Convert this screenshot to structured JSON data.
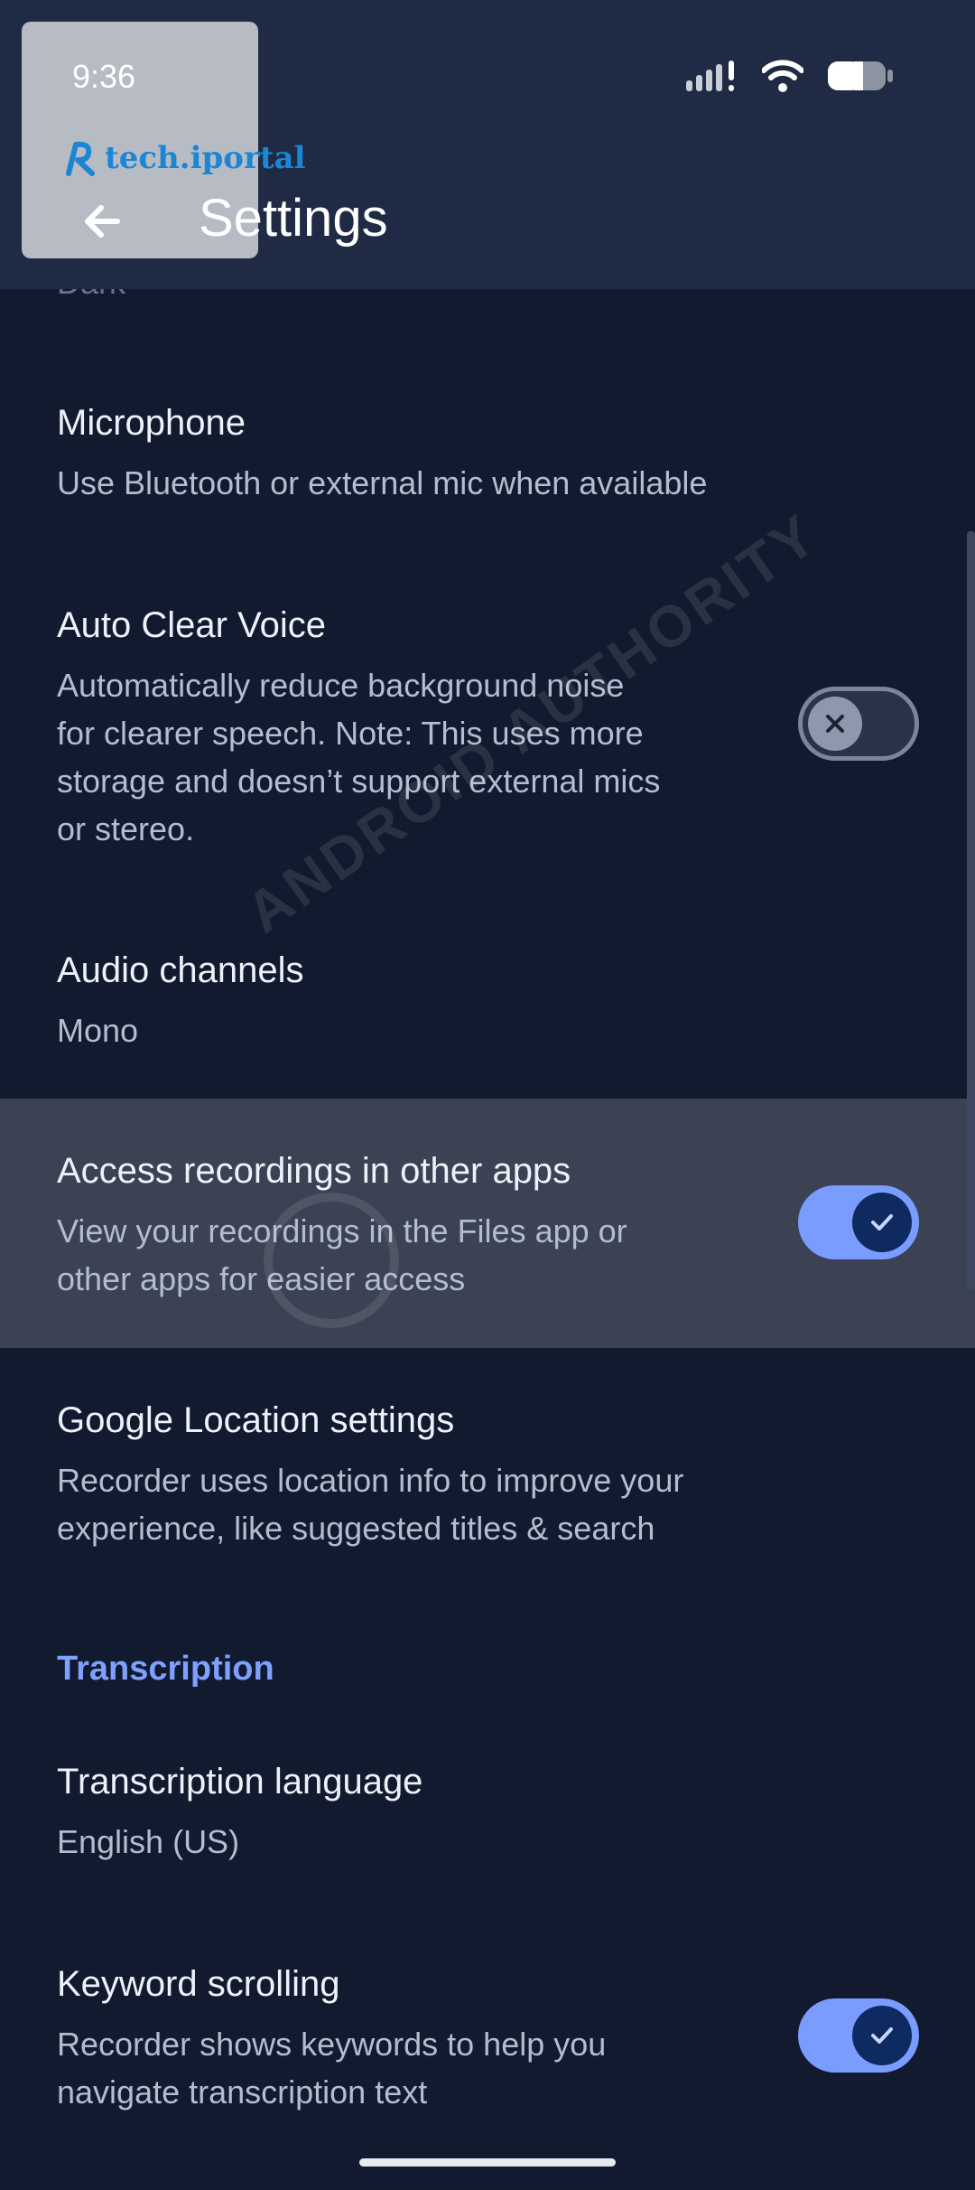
{
  "status_bar": {
    "time": "9:36"
  },
  "watermark_logo": {
    "text": "tech.iportal"
  },
  "app_bar": {
    "title": "Settings"
  },
  "partial_item": {
    "text": "Dark"
  },
  "items": {
    "microphone": {
      "title": "Microphone",
      "subtitle": "Use Bluetooth or external mic when available"
    },
    "auto_clear_voice": {
      "title": "Auto Clear Voice",
      "subtitle": [
        "Automatically reduce background noise",
        "for clearer speech. Note: This uses more",
        "storage and doesn’t support external mics",
        "or stereo."
      ],
      "toggle": "off"
    },
    "audio_channels": {
      "title": "Audio channels",
      "subtitle": "Mono"
    },
    "access_recordings": {
      "title": "Access recordings in other apps",
      "subtitle": [
        "View your recordings in the Files app or",
        "other apps for easier access"
      ],
      "toggle": "on"
    },
    "google_location": {
      "title": "Google Location settings",
      "subtitle": [
        "Recorder uses location info to improve your",
        "experience, like suggested titles & search"
      ]
    },
    "transcription_language": {
      "title": "Transcription language",
      "subtitle": "English (US)"
    },
    "keyword_scrolling": {
      "title": "Keyword scrolling",
      "subtitle": [
        "Recorder shows keywords to help you",
        "navigate transcription text"
      ],
      "toggle": "on"
    }
  },
  "section_header": {
    "transcription": "Transcription"
  },
  "watermark": {
    "text": "ANDROID AUTHORITY"
  },
  "colors": {
    "background": "#111a2e",
    "app_bar": "#1f2a45",
    "accent": "#7b9cff",
    "section_header": "#7ea0ff",
    "highlight": "#3a4254"
  },
  "icons": {
    "back": "arrow-left-icon",
    "signal": "signal-icon",
    "wifi": "wifi-icon",
    "battery": "battery-icon",
    "toggle_off": "close-icon",
    "toggle_on": "check-icon"
  }
}
